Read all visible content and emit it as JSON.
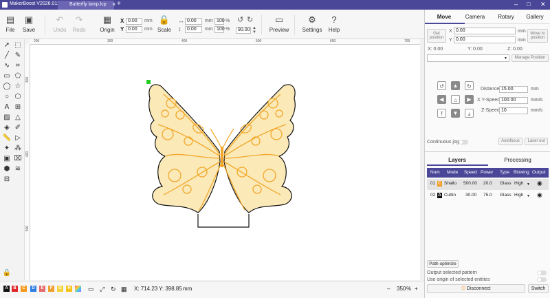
{
  "titlebar": {
    "app_title": "MakerBoost V2026.0115_Global",
    "tab_title": "Butterfly lamp.lcp",
    "tab_close": "×",
    "tab_add": "+",
    "minimize": "–",
    "maximize": "□",
    "close": "✕"
  },
  "toolbar": {
    "file": "File",
    "save": "Save",
    "undo": "Undo",
    "redo": "Redo",
    "origin": "Origin",
    "x_label": "X",
    "y_label": "Y",
    "x_value": "0.00",
    "y_value": "0.00",
    "mm1": "mm",
    "mm2": "mm",
    "scale": "Scale",
    "width_value": "0.00",
    "height_value": "0.00",
    "w_unit": "mm",
    "h_unit": "mm",
    "w_percent": "100",
    "h_percent": "100",
    "pct1": "%",
    "pct2": "%",
    "rotation": "90.00",
    "preview": "Preview",
    "settings": "Settings",
    "help": "Help"
  },
  "ruler": {
    "top_ticks": [
      "200",
      "300",
      "400",
      "500",
      "600",
      "700"
    ],
    "left_ticks": [
      "300",
      "400",
      "500"
    ]
  },
  "statusbar": {
    "colors": [
      {
        "label": "A",
        "color": "#111111"
      },
      {
        "label": "B",
        "color": "#e0262b"
      },
      {
        "label": "C",
        "color": "#f39a1d"
      },
      {
        "label": "D",
        "color": "#2f7de1"
      },
      {
        "label": "E",
        "color": "#e56c6c"
      },
      {
        "label": "F",
        "color": "#f0a030"
      },
      {
        "label": "G",
        "color": "#f2d23a"
      },
      {
        "label": "H",
        "color": "#f7c21a"
      }
    ],
    "x_readout": "X: 714.23",
    "y_readout": "Y: 398.85",
    "unit": "mm",
    "zoom_minus": "–",
    "zoom": "350",
    "zoom_pct": "%",
    "zoom_plus": "+"
  },
  "panel": {
    "tabs": [
      "Move",
      "Camera",
      "Rotary",
      "Gallery"
    ],
    "active_tab": "Move",
    "get_position": "Get position",
    "move_to_position": "Move to position",
    "px_label": "X",
    "py_label": "Y",
    "px_value": "0.00",
    "py_value": "0.00",
    "pmm1": "mm",
    "pmm2": "mm",
    "coord_x": "X: 0.00",
    "coord_y": "Y: 0.00",
    "coord_z": "Z: 0.00",
    "manage_position": "Manage Position",
    "distance_label": "Distance",
    "distance_value": "15.00",
    "distance_unit": "mm",
    "xy_speed_label": "X Y-Speed",
    "xy_speed_value": "100.00",
    "xy_speed_unit": "mm/s",
    "z_speed_label": "Z-Speed",
    "z_speed_value": "10",
    "z_speed_unit": "mm/s",
    "continuous_jog": "Continuous jog",
    "autofocus": "Autofocus",
    "laser_out": "Laser out",
    "sub_tabs": [
      "Layers",
      "Processing"
    ],
    "layer_headers": [
      "Num",
      "Mode",
      "Speed",
      "Power",
      "Type",
      "Blowing",
      "Output"
    ],
    "layers": [
      {
        "num": "01",
        "chip": "C",
        "chip_color": "#f39a1d",
        "mode": "Shallo",
        "speed": "500.00",
        "power": "20.0",
        "type": "Glass",
        "blowing": "High"
      },
      {
        "num": "02",
        "chip": "A",
        "chip_color": "#111111",
        "mode": "Cuttin",
        "speed": "30.00",
        "power": "75.0",
        "type": "Glass",
        "blowing": "High"
      }
    ],
    "path_optimize": "Path optimize",
    "output_selected": "Output selected pattern",
    "use_origin": "Use origin of selected entities",
    "disconnect": "Disconnect",
    "switch": "Switch"
  }
}
